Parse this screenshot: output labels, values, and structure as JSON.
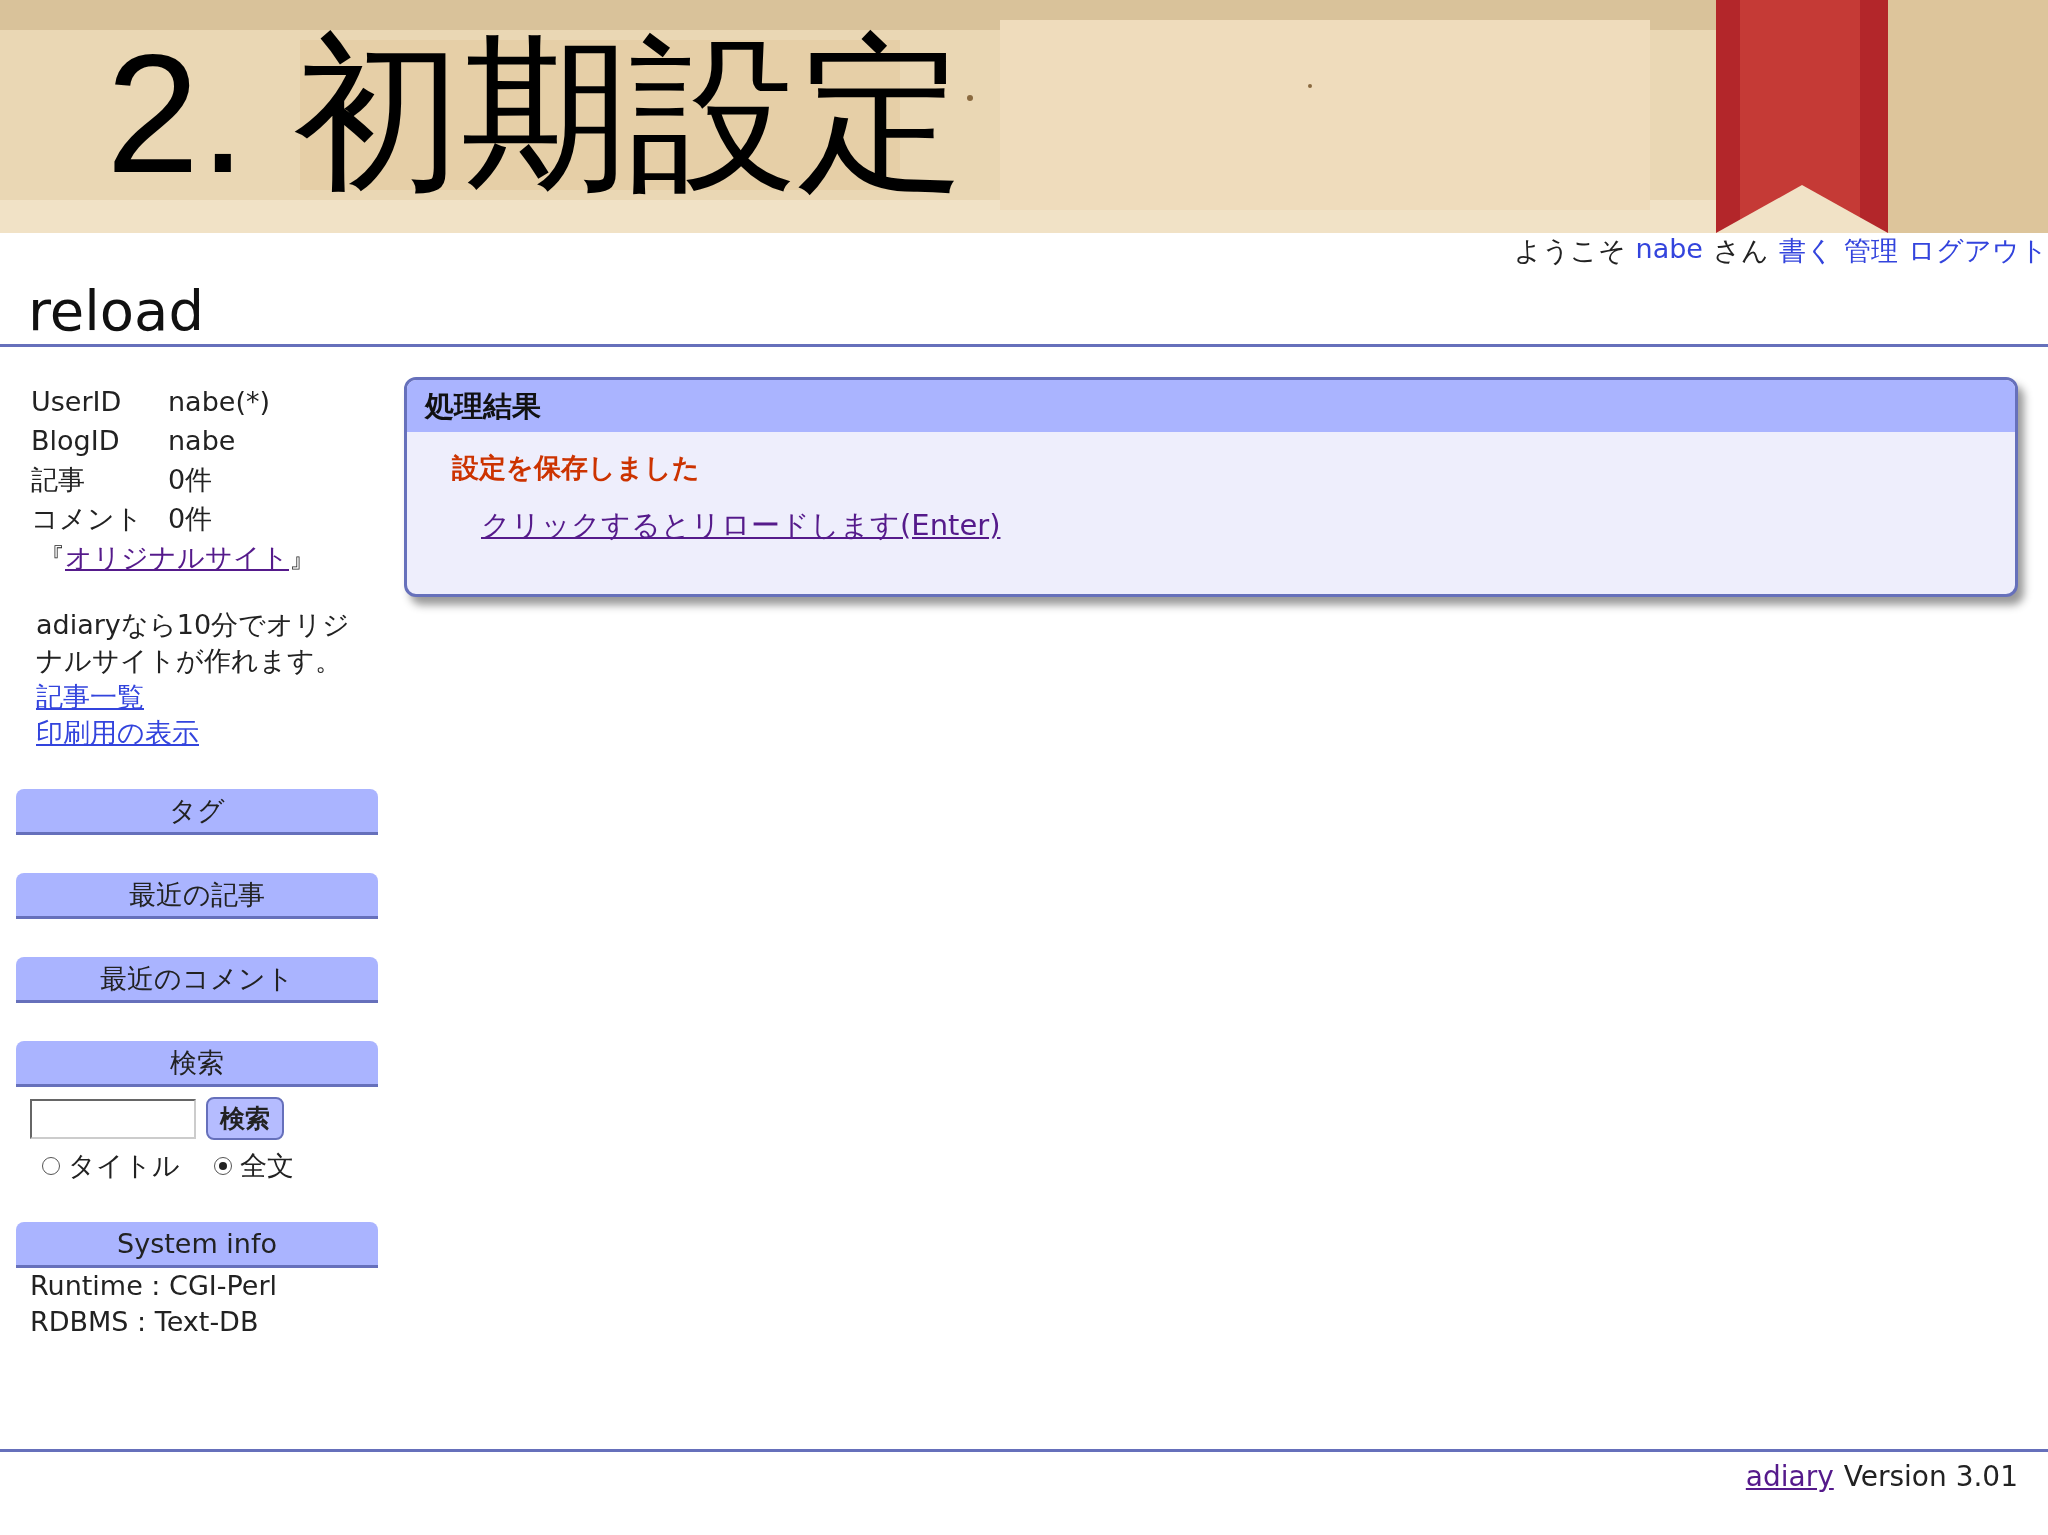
{
  "slide_title": "2. 初期設定",
  "user_bar": {
    "greeting": "ようこそ",
    "user": "nabe",
    "suffix": "さん",
    "links": [
      "書く",
      "管理",
      "ログアウト"
    ]
  },
  "blog_title": "reload",
  "sidebar": {
    "info": [
      {
        "label": "UserID",
        "value": "nabe(*)"
      },
      {
        "label": "BlogID",
        "value": "nabe"
      },
      {
        "label": "記事",
        "value": "0件"
      },
      {
        "label": "コメント",
        "value": "0件"
      }
    ],
    "site": {
      "open": "『",
      "link": "オリジナルサイト",
      "close": "』"
    },
    "description": "adiaryなら10分でオリジナルサイトが作れます。",
    "links": [
      "記事一覧",
      "印刷用の表示"
    ],
    "sections": [
      "タグ",
      "最近の記事",
      "最近のコメント"
    ],
    "search": {
      "heading": "検索",
      "button": "検索",
      "options": [
        {
          "label": "タイトル",
          "selected": false
        },
        {
          "label": "全文",
          "selected": true
        }
      ]
    },
    "system_info": {
      "heading": "System info",
      "lines": [
        "Runtime : CGI-Perl",
        "RDBMS : Text-DB"
      ]
    }
  },
  "result": {
    "title": "処理結果",
    "message": "設定を保存しました",
    "link": "クリックするとリロードします(Enter)"
  },
  "footer": {
    "link": "adiary",
    "text": "Version 3.01"
  }
}
